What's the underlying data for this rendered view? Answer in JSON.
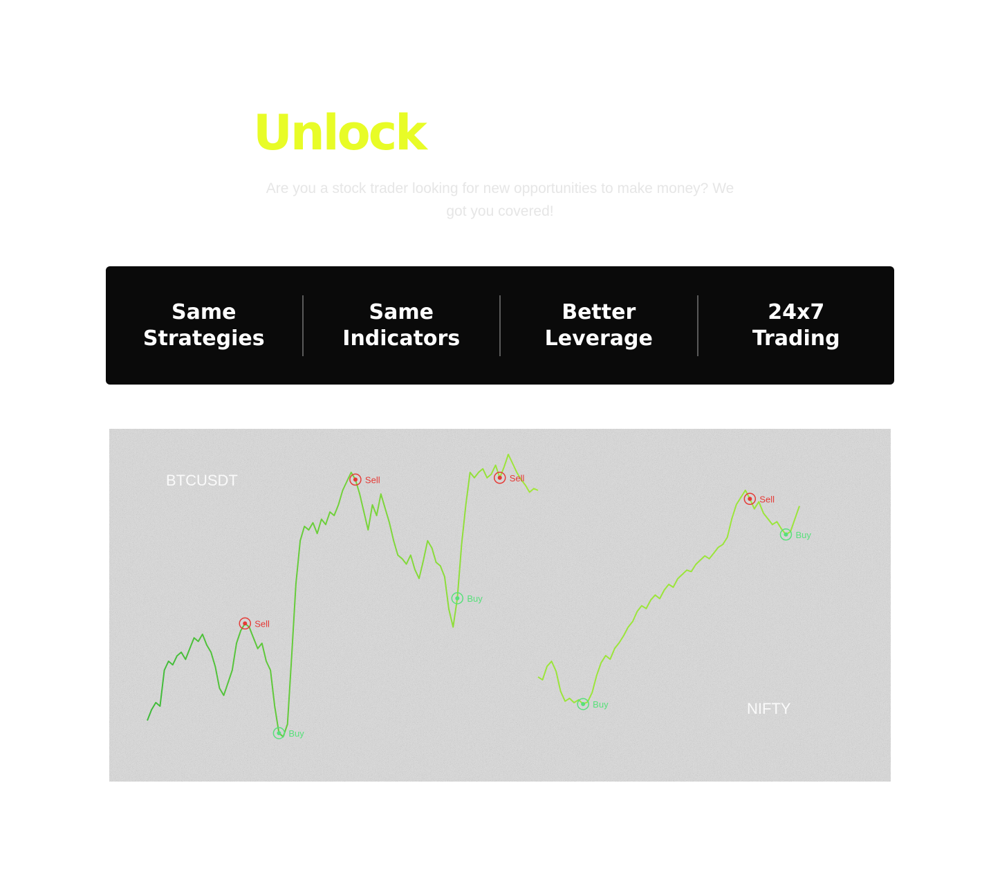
{
  "hero": {
    "title": "Unlock",
    "subtitle": "Are you a stock trader looking for new opportunities to make money? We got you covered!"
  },
  "features": [
    {
      "label": "Same\nStrategies"
    },
    {
      "label": "Same\nIndicators"
    },
    {
      "label": "Better\nLeverage"
    },
    {
      "label": "24x7\nTrading"
    }
  ],
  "colors": {
    "accent": "#e8fc27",
    "bar_background": "#0a0a0a",
    "line_green": "#4cc93c",
    "line_lime": "#9be53a",
    "sell_red": "#e53935",
    "buy_green": "#57e07a"
  },
  "chart_data": [
    {
      "type": "line",
      "title": "BTCUSDT",
      "series": [
        {
          "values": [
            12,
            18,
            22,
            20,
            40,
            45,
            43,
            48,
            50,
            46,
            52,
            58,
            56,
            60,
            54,
            50,
            42,
            30,
            26,
            33,
            40,
            55,
            62,
            66,
            64,
            58,
            52,
            55,
            45,
            40,
            20,
            5,
            3,
            10,
            48,
            88,
            112,
            120,
            118,
            122,
            116,
            124,
            121,
            128,
            126,
            132,
            140,
            145,
            150,
            146,
            138,
            128,
            118,
            132,
            126,
            138,
            130,
            122,
            112,
            104,
            102,
            99,
            104,
            96,
            91,
            101,
            112,
            108,
            100,
            98,
            92,
            74,
            64,
            80,
            110,
            132,
            150,
            147,
            150,
            152,
            147,
            149,
            154,
            147,
            153,
            160,
            155,
            150,
            146,
            143,
            139,
            141,
            140
          ]
        }
      ],
      "markers": [
        {
          "label": "Sell",
          "index": 23
        },
        {
          "label": "Buy",
          "index": 31
        },
        {
          "label": "Sell",
          "index": 49
        },
        {
          "label": "Buy",
          "index": 73
        },
        {
          "label": "Sell",
          "index": 83
        }
      ]
    },
    {
      "type": "line",
      "title": "NIFTY",
      "series": [
        {
          "values": [
            40,
            36,
            55,
            62,
            48,
            20,
            6,
            10,
            4,
            8,
            2,
            5,
            18,
            42,
            60,
            70,
            65,
            80,
            88,
            98,
            110,
            118,
            132,
            140,
            136,
            148,
            155,
            150,
            162,
            170,
            166,
            178,
            184,
            190,
            188,
            198,
            204,
            210,
            206,
            214,
            222,
            226,
            236,
            262,
            282,
            292,
            302,
            290,
            276,
            286,
            270,
            262,
            254,
            258,
            248,
            240,
            244,
            262,
            280
          ]
        }
      ],
      "markers": [
        {
          "label": "Buy",
          "index": 10
        },
        {
          "label": "Sell",
          "index": 47
        },
        {
          "label": "Buy",
          "index": 55
        }
      ]
    }
  ]
}
